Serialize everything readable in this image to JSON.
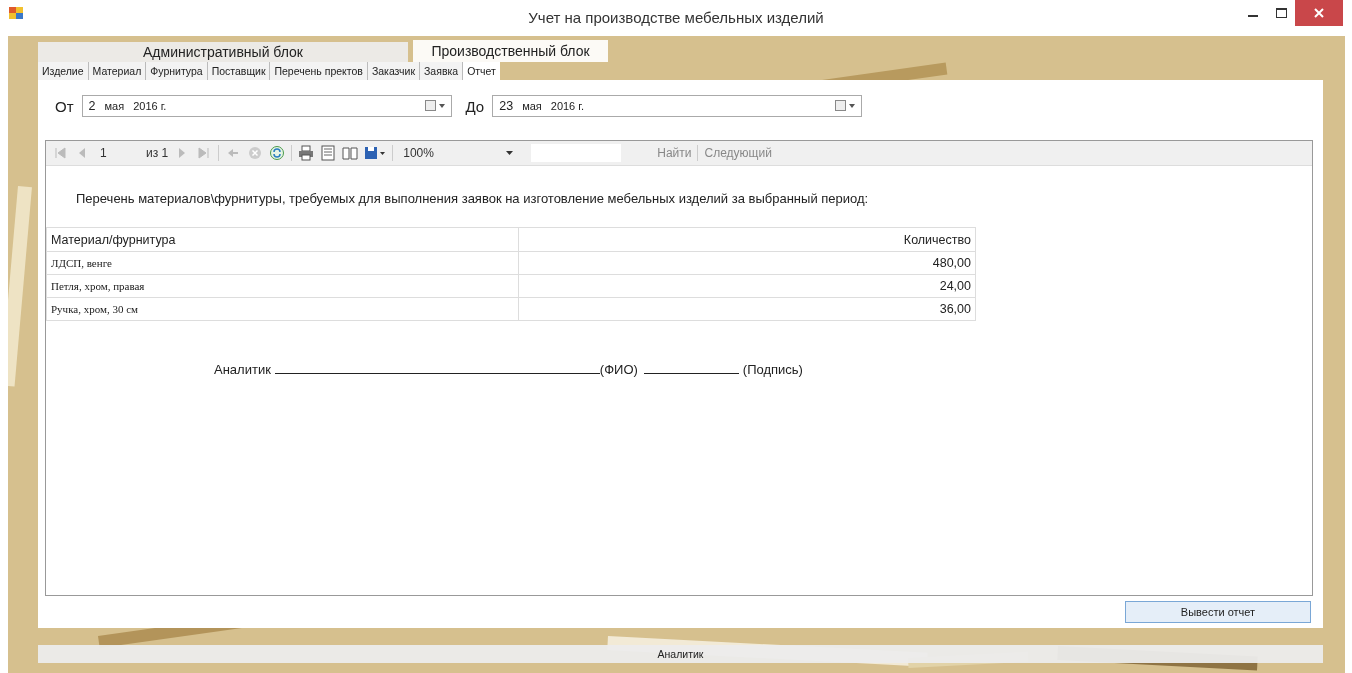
{
  "window": {
    "title": "Учет на производстве мебельных изделий"
  },
  "top_tabs": [
    {
      "label": "Административный блок",
      "selected": false
    },
    {
      "label": "Производственный блок",
      "selected": true
    }
  ],
  "sub_tabs": [
    {
      "label": "Изделие",
      "selected": false
    },
    {
      "label": "Материал",
      "selected": false
    },
    {
      "label": "Фурнитура",
      "selected": false
    },
    {
      "label": "Поставщик",
      "selected": false
    },
    {
      "label": "Перечень пректов",
      "selected": false
    },
    {
      "label": "Заказчик",
      "selected": false
    },
    {
      "label": "Заявка",
      "selected": false
    },
    {
      "label": "Отчет",
      "selected": true
    }
  ],
  "date_from": {
    "label": "От",
    "day": "2",
    "month": "мая",
    "year": "2016 г."
  },
  "date_to": {
    "label": "До",
    "day": "23",
    "month": "мая",
    "year": "2016 г."
  },
  "toolbar": {
    "page": "1",
    "page_total": "из 1",
    "zoom": "100%",
    "find": "Найти",
    "next": "Следующий"
  },
  "report": {
    "heading": "Перечень материалов\\фурнитуры, требуемых для выполнения заявок на изготовление мебельных изделий за выбранный период:",
    "columns": [
      "Материал/фурнитура",
      "Количество"
    ],
    "rows": [
      {
        "item": "ЛДСП, венге",
        "quantity": "480,00"
      },
      {
        "item": "Петля, хром,  правая",
        "quantity": "24,00"
      },
      {
        "item": "Ручка, хром, 30 см",
        "quantity": "36,00"
      }
    ],
    "signature": {
      "role": "Аналитик",
      "name_hint": "(ФИО)",
      "sign_hint": "(Подпись)"
    }
  },
  "button": "Вывести отчет",
  "status_bar": "Аналитик"
}
